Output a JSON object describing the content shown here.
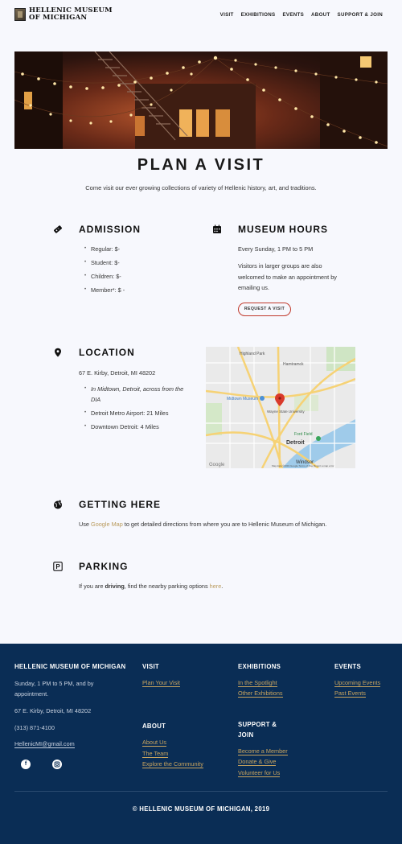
{
  "header": {
    "logo_line1": "HELLENIC MUSEUM",
    "logo_line2": "OF MICHIGAN",
    "nav": [
      "VISIT",
      "EXHIBITIONS",
      "EVENTS",
      "ABOUT",
      "SUPPORT & JOIN"
    ]
  },
  "page": {
    "title": "PLAN A VISIT",
    "intro": "Come visit our ever growing collections of variety of Hellenic history, art, and traditions."
  },
  "admission": {
    "title": "ADMISSION",
    "items": [
      "Regular: $-",
      "Student: $-",
      "Children: $-",
      "Member*: $ -"
    ]
  },
  "hours": {
    "title": "MUSEUM HOURS",
    "schedule": "Every Sunday, 1 PM to 5 PM",
    "groups_line1": "Visitors in larger groups are also",
    "groups_line2": "welcomed to make an appointment by",
    "groups_line3": "emailing us.",
    "button": "REQUEST A VISIT"
  },
  "location": {
    "title": "LOCATION",
    "address": "67 E. Kirby, Detroit, MI 48202",
    "items": [
      "In Midtown, Detroit, across from the",
      "DIA",
      "Detroit Metro Airport: 21 Miles",
      "Downtown Detroit: 4 Miles"
    ]
  },
  "map": {
    "labels": [
      "Highland Park",
      "Hamtramck",
      "Midtown Museum",
      "Wayne State University",
      "Ford Field",
      "Detroit",
      "Windsor"
    ],
    "attribution": "Map data ©2019 Google   Terms of Use   Report a map error",
    "google": "Google"
  },
  "getting_here": {
    "title": "GETTING HERE",
    "pre": "Use ",
    "link": "Google Map",
    "post": " to get detailed directions from where you are to Hellenic Museum of Michigan."
  },
  "parking": {
    "title": "PARKING",
    "pre": "If you are ",
    "bold": "driving",
    "mid": ", find the nearby parking options ",
    "link": "here",
    "post": "."
  },
  "footer": {
    "org_title": "HELLENIC MUSEUM OF MICHIGAN",
    "hours_line1": "Sunday, 1 PM to 5 PM, and by",
    "hours_line2": "appointment.",
    "address": "67 E. Kirby, Detroit, MI 48202",
    "phone": "(313) 871-4100",
    "email": "HellenicMI@gmail.com",
    "visit_title": "VISIT",
    "visit_links": [
      "Plan Your Visit"
    ],
    "exhibitions_title": "EXHIBITIONS",
    "exhibitions_links": [
      "In the Spotlight",
      "Other Exhibitions"
    ],
    "events_title": "EVENTS",
    "events_links": [
      "Upcoming Events",
      "Past Events"
    ],
    "about_title": "ABOUT",
    "about_links": [
      "About Us",
      "The Team",
      "Explore the Community"
    ],
    "support_title_line1": "SUPPORT &",
    "support_title_line2": "JOIN",
    "support_links": [
      "Become a Member",
      "Donate & Give",
      "Volunteer for Us"
    ],
    "copyright": "© HELLENIC MUSEUM OF MICHIGAN,  2019"
  },
  "icons": {
    "admission": "ticket-icon",
    "hours": "calendar-icon",
    "location": "map-pin-icon",
    "getting_here": "globe-directions-icon",
    "parking": "parking-icon",
    "facebook": "facebook-icon",
    "instagram": "instagram-icon"
  },
  "colors": {
    "footer_bg": "#0a2d55",
    "link_gold": "#b99a5c",
    "button_border": "#c0392b",
    "page_bg": "#f7f8fd"
  }
}
